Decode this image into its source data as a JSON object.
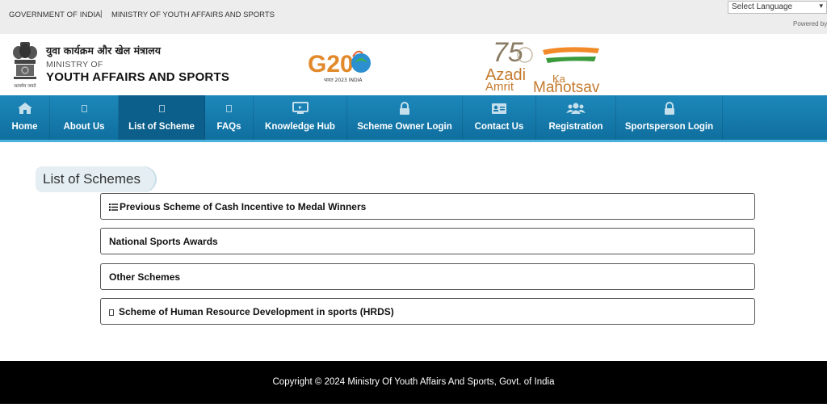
{
  "topbar": {
    "gov_label": "GOVERNMENT OF INDIA",
    "separator": "|",
    "ministry_label": "MINISTRY OF YOUTH AFFAIRS AND SPORTS",
    "language_select": "Select Language",
    "powered_by": "Powered by"
  },
  "header": {
    "emblem_caption": "सत्यमेव जयते",
    "hindi_name": "युवा कार्यक्रम और खेल मंत्रालय",
    "ministry_of": "MINISTRY OF",
    "ministry_name": "YOUTH AFFAIRS AND SPORTS",
    "g20_text": "G20",
    "g20_caption": "भारत 2023 INDIA",
    "azadi_75": "75",
    "azadi_line1": "Azadi",
    "azadi_ka": "Ka",
    "azadi_amrit": "Amrit",
    "azadi_mahotsav": "Mahotsav"
  },
  "nav": {
    "items": [
      {
        "label": "Home",
        "icon": "home-icon"
      },
      {
        "label": "About Us",
        "icon": "square-icon"
      },
      {
        "label": "List of Scheme",
        "icon": "square-icon"
      },
      {
        "label": "FAQs",
        "icon": "square-icon"
      },
      {
        "label": "Knowledge Hub",
        "icon": "monitor-icon"
      },
      {
        "label": "Scheme Owner Login",
        "icon": "lock-icon"
      },
      {
        "label": "Contact Us",
        "icon": "id-card-icon"
      },
      {
        "label": "Registration",
        "icon": "users-icon"
      },
      {
        "label": "Sportsperson Login",
        "icon": "lock-icon"
      }
    ],
    "active": "List of Scheme"
  },
  "main": {
    "title": "List of Schemes",
    "schemes": [
      {
        "label": "Previous Scheme of Cash Incentive to Medal Winners",
        "icon": "list-icon"
      },
      {
        "label": "National Sports Awards",
        "icon": ""
      },
      {
        "label": "Other Schemes",
        "icon": ""
      },
      {
        "label": "Scheme of Human Resource Development in sports (HRDS)",
        "icon": "square-icon"
      }
    ]
  },
  "footer": {
    "copyright": "Copyright © 2024 Ministry Of Youth Affairs And Sports, Govt. of India"
  },
  "colors": {
    "nav_bg": "#1678ab",
    "nav_active": "#0c5f8a",
    "topbar_bg": "#ededed",
    "footer_bg": "#000000",
    "title_bg": "#e4eef3"
  }
}
